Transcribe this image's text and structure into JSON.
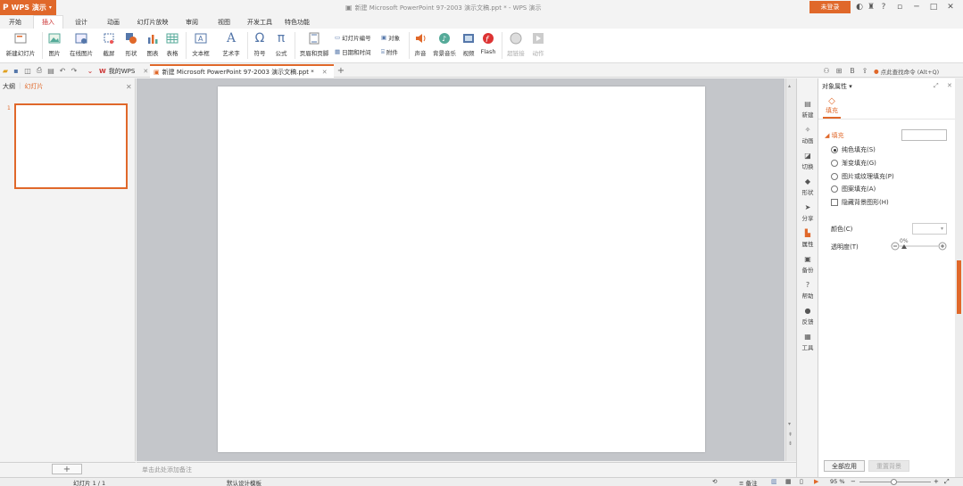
{
  "app": {
    "logo_text": "WPS 演示",
    "doc_title": "新建 Microsoft PowerPoint 97-2003 演示文稿.ppt * - WPS 演示",
    "login_label": "未登录"
  },
  "menu": {
    "tabs": [
      "开始",
      "插入",
      "设计",
      "动画",
      "幻灯片放映",
      "审阅",
      "视图",
      "开发工具",
      "特色功能"
    ],
    "active": "插入"
  },
  "ribbon": {
    "new_slide": "新建幻灯片",
    "picture": "图片",
    "online_picture": "在线图片",
    "screenshot": "截屏",
    "shape": "形状",
    "chart": "图表",
    "table": "表格",
    "textbox": "文本框",
    "wordart": "艺术字",
    "symbol": "符号",
    "formula": "公式",
    "header_footer": "页眉和页脚",
    "slide_number": "幻灯片编号",
    "datetime": "日期和时间",
    "object": "对象",
    "attachment": "附件",
    "sound": "声音",
    "bg_music": "背景音乐",
    "video": "视频",
    "flash": "Flash",
    "hyperlink": "超链接",
    "action": "动作"
  },
  "tabbar": {
    "tab1": "我的WPS",
    "tab2": "新建 Microsoft PowerPoint 97-2003 演示文稿.ppt *",
    "search_cmd": "点此查找命令 (Alt+Q)"
  },
  "left_pane": {
    "tab_outline": "大纲",
    "tab_slides": "幻灯片",
    "slide_num": "1"
  },
  "notes": {
    "placeholder": "单击此处添加备注"
  },
  "status": {
    "slide_info": "幻灯片 1 / 1",
    "template": "默认设计模板",
    "notes_btn": "备注",
    "zoom": "95 %"
  },
  "side_tabs": [
    "新建",
    "动画",
    "切换",
    "形状",
    "分享",
    "属性",
    "备份",
    "帮助",
    "反馈",
    "工具"
  ],
  "props": {
    "title": "对象属性",
    "fill_tab": "填充",
    "fill_section": "填充",
    "options": [
      "纯色填充(S)",
      "渐变填充(G)",
      "图片或纹理填充(P)",
      "图案填充(A)"
    ],
    "selected": "纯色填充(S)",
    "hide_bg": "隐藏背景图形(H)",
    "color_label": "颜色(C)",
    "transparency_label": "透明度(T)",
    "transparency_value": "0%",
    "apply_all": "全部应用",
    "reset_bg": "重置背景"
  }
}
